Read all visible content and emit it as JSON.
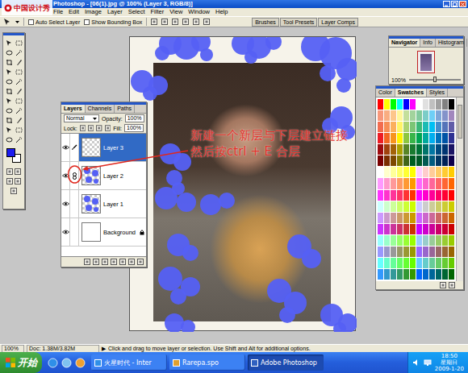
{
  "window": {
    "title": "Photoshop - [06(1).jpg @ 100% (Layer 3, RGB/8)]"
  },
  "logo": {
    "text": "中国设计秀"
  },
  "menu": [
    "File",
    "Edit",
    "Image",
    "Layer",
    "Select",
    "Filter",
    "View",
    "Window",
    "Help"
  ],
  "options_bar": {
    "checkboxes": [
      {
        "label": "Auto Select Layer",
        "checked": false
      },
      {
        "label": "Show Bounding Box",
        "checked": false
      }
    ],
    "palette_well": [
      "Brushes",
      "Tool Presets",
      "Layer Comps"
    ]
  },
  "toolbox": {
    "foreground": "#1c1cf0",
    "background": "#ffffff"
  },
  "layers_panel": {
    "tabs": [
      {
        "label": "Layers",
        "selected": true
      },
      {
        "label": "Channels",
        "selected": false
      },
      {
        "label": "Paths",
        "selected": false
      }
    ],
    "blend_mode": "Normal",
    "opacity_label": "Opacity:",
    "opacity": "100%",
    "lock_label": "Lock:",
    "fill_label": "Fill:",
    "fill": "100%",
    "layers": [
      {
        "name": "Layer 3",
        "visible": true,
        "selected": true,
        "linked": false,
        "locked": false,
        "kind": "empty"
      },
      {
        "name": "Layer 2",
        "visible": true,
        "selected": false,
        "linked": true,
        "locked": false,
        "kind": "painted"
      },
      {
        "name": "Layer 1",
        "visible": true,
        "selected": false,
        "linked": false,
        "locked": false,
        "kind": "painted"
      },
      {
        "name": "Background",
        "visible": true,
        "selected": false,
        "linked": false,
        "locked": true,
        "kind": "background"
      }
    ]
  },
  "annotation": {
    "lines": [
      "新建一个新层与下层建立链接",
      "然后按ctrl + E 合层"
    ]
  },
  "navigator": {
    "tabs": [
      {
        "label": "Navigator",
        "selected": true
      },
      {
        "label": "Info",
        "selected": false
      },
      {
        "label": "Histogram",
        "selected": false
      }
    ],
    "zoom": "100%",
    "level": 0.5
  },
  "swatches_panel": {
    "tabs": [
      {
        "label": "Color",
        "selected": false
      },
      {
        "label": "Swatches",
        "selected": true
      },
      {
        "label": "Styles",
        "selected": false
      }
    ],
    "colors": [
      "#ff0000",
      "#ffff00",
      "#00ff00",
      "#00ffff",
      "#0000ff",
      "#ff00ff",
      "#ffffff",
      "#e0e0e0",
      "#c0c0c0",
      "#a0a0a0",
      "#808080",
      "#000000",
      "#f7977a",
      "#f9ad81",
      "#fdc68a",
      "#fff79a",
      "#c4df9b",
      "#a2d39c",
      "#82ca9d",
      "#7bcdc8",
      "#6ecff6",
      "#7ea7d8",
      "#8493ca",
      "#a187be",
      "#f26c4f",
      "#f68e55",
      "#fbaf5c",
      "#fff467",
      "#acd372",
      "#7cc576",
      "#3bb878",
      "#1abbb4",
      "#00bff3",
      "#438ccb",
      "#5574b9",
      "#605ca8",
      "#ed1c24",
      "#f26522",
      "#f7941d",
      "#fff200",
      "#8dc63f",
      "#39b54a",
      "#00a651",
      "#00a99d",
      "#00aeef",
      "#0072bc",
      "#0054a6",
      "#2e3192",
      "#9e0b0f",
      "#a0410d",
      "#a36209",
      "#aba000",
      "#598527",
      "#197b30",
      "#007236",
      "#00746b",
      "#0076a3",
      "#004a80",
      "#003471",
      "#1b1464",
      "#790000",
      "#7b2e00",
      "#7d4900",
      "#827b00",
      "#406618",
      "#005e20",
      "#005826",
      "#005952",
      "#005b7f",
      "#003663",
      "#002157",
      "#0d004c",
      "#ffffff",
      "#ffffcc",
      "#ffff99",
      "#ffff66",
      "#ffff33",
      "#ffff00",
      "#ffccff",
      "#ffcccc",
      "#ffcc99",
      "#ffcc66",
      "#ffcc33",
      "#ffcc00",
      "#ff99ff",
      "#ff99cc",
      "#ff9999",
      "#ff9966",
      "#ff9933",
      "#ff9900",
      "#ff66ff",
      "#ff66cc",
      "#ff6699",
      "#ff6666",
      "#ff6633",
      "#ff6600",
      "#ff33ff",
      "#ff33cc",
      "#ff3399",
      "#ff3366",
      "#ff3333",
      "#ff3300",
      "#ff00ff",
      "#ff00cc",
      "#ff0099",
      "#ff0066",
      "#ff0033",
      "#ff0000",
      "#ccffff",
      "#ccffcc",
      "#ccff99",
      "#ccff66",
      "#ccff33",
      "#ccff00",
      "#ccccff",
      "#cccccc",
      "#cccc99",
      "#cccc66",
      "#cccc33",
      "#cccc00",
      "#cc99ff",
      "#cc99cc",
      "#cc9999",
      "#cc9966",
      "#cc9933",
      "#cc9900",
      "#cc66ff",
      "#cc66cc",
      "#cc6699",
      "#cc6666",
      "#cc6633",
      "#cc6600",
      "#cc33ff",
      "#cc33cc",
      "#cc3399",
      "#cc3366",
      "#cc3333",
      "#cc3300",
      "#cc00ff",
      "#cc00cc",
      "#cc0099",
      "#cc0066",
      "#cc0033",
      "#cc0000",
      "#99ffff",
      "#99ffcc",
      "#99ff99",
      "#99ff66",
      "#99ff33",
      "#99ff00",
      "#99ccff",
      "#99cccc",
      "#99cc99",
      "#99cc66",
      "#99cc33",
      "#99cc00",
      "#9999ff",
      "#9999cc",
      "#999999",
      "#999966",
      "#999933",
      "#999900",
      "#9966ff",
      "#9966cc",
      "#996699",
      "#996666",
      "#996633",
      "#996600",
      "#66ffff",
      "#66ffcc",
      "#66ff99",
      "#66ff66",
      "#66ff33",
      "#66ff00",
      "#66ccff",
      "#66cccc",
      "#66cc99",
      "#66cc66",
      "#66cc33",
      "#66cc00",
      "#3399ff",
      "#3399cc",
      "#339999",
      "#339966",
      "#339933",
      "#339900",
      "#0066ff",
      "#0066cc",
      "#006699",
      "#006666",
      "#006633",
      "#006600"
    ]
  },
  "status_bar": {
    "zoom": "100%",
    "doc": "Doc: 1.38M/3.82M",
    "arrow": "▶",
    "hint": "Click and drag to move layer or selection. Use Shift and Alt for additional options."
  },
  "taskbar": {
    "start": "开始",
    "tasks": [
      {
        "label": "火星时代 - Inter",
        "selected": false
      },
      {
        "label": "Rarepa.spo",
        "selected": false
      },
      {
        "label": "Adobe Photoshop",
        "selected": true
      }
    ],
    "clock": {
      "time": "18:50",
      "weekday": "星期日",
      "date": "2009-1-20"
    }
  }
}
